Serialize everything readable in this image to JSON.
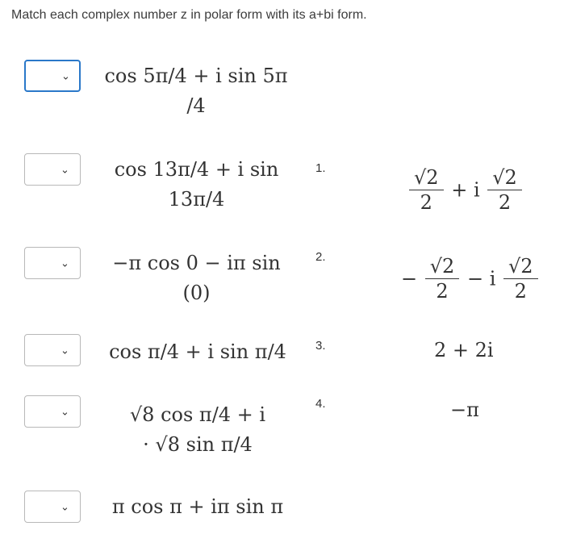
{
  "prompt": "Match each complex number z in polar form with its a+bi form.",
  "chevron": "⌄",
  "items": [
    {
      "line1": "cos 5π/4 + i sin 5π",
      "line2": "/4"
    },
    {
      "line1": "cos 13π/4 + i sin",
      "line2": "13π/4"
    },
    {
      "line1": "−π cos 0 − iπ sin",
      "line2": "(0)"
    },
    {
      "line1": "cos π/4 + i sin π/4",
      "line2": ""
    },
    {
      "line1": "√8 cos π/4 + i",
      "line2": "· √8 sin π/4"
    },
    {
      "line1": "π cos π + iπ sin π",
      "line2": ""
    }
  ],
  "answers": [
    {
      "number": "1.",
      "sign": "",
      "num": "√2",
      "den": "2",
      "mid": "+ i",
      "num2": "√2",
      "den2": "2"
    },
    {
      "number": "2.",
      "sign": "−",
      "num": "√2",
      "den": "2",
      "mid": "− i",
      "num2": "√2",
      "den2": "2"
    },
    {
      "number": "3.",
      "text": "2 + 2i"
    },
    {
      "number": "4.",
      "text": "−π"
    }
  ]
}
